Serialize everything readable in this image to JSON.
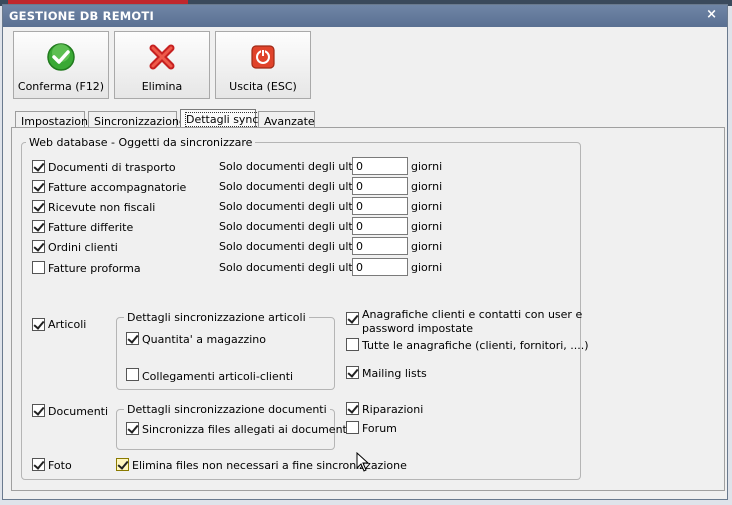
{
  "window": {
    "title": "GESTIONE DB REMOTI",
    "close_glyph": "×"
  },
  "toolbar": {
    "confirm_label": "Conferma (F12)",
    "delete_label": "Elimina",
    "exit_label": "Uscita (ESC)",
    "icons": {
      "confirm": "green-check-icon",
      "delete": "red-x-icon",
      "exit": "power-exit-icon"
    }
  },
  "tabs": [
    {
      "label": "Impostazioni",
      "active": false
    },
    {
      "label": "Sincronizzazione",
      "active": false
    },
    {
      "label": "Dettagli sync",
      "active": true
    },
    {
      "label": "Avanzate",
      "active": false
    }
  ],
  "main_group": {
    "title": "Web database - Oggetti da sincronizzare"
  },
  "documents": [
    {
      "label": "Documenti di trasporto",
      "checked": true,
      "prefix": "Solo documenti degli ultimi",
      "value": "0",
      "suffix": "giorni"
    },
    {
      "label": "Fatture accompagnatorie",
      "checked": true,
      "prefix": "Solo documenti degli ultimi",
      "value": "0",
      "suffix": "giorni"
    },
    {
      "label": "Ricevute non fiscali",
      "checked": true,
      "prefix": "Solo documenti degli ultimi",
      "value": "0",
      "suffix": "giorni"
    },
    {
      "label": "Fatture differite",
      "checked": true,
      "prefix": "Solo documenti degli ultimi",
      "value": "0",
      "suffix": "giorni"
    },
    {
      "label": "Ordini clienti",
      "checked": true,
      "prefix": "Solo documenti degli ultimi",
      "value": "0",
      "suffix": "giorni"
    },
    {
      "label": "Fatture proforma",
      "checked": false,
      "prefix": "Solo documenti degli ultimi",
      "value": "0",
      "suffix": "giorni"
    }
  ],
  "articoli": {
    "label": "Articoli",
    "checked": true
  },
  "articoli_details": {
    "title": "Dettagli sincronizzazione articoli",
    "qty_label": "Quantita' a magazzino",
    "qty_checked": true,
    "links_label": "Collegamenti articoli-clienti",
    "links_checked": false
  },
  "documenti": {
    "label": "Documenti",
    "checked": true
  },
  "documenti_details": {
    "title": "Dettagli sincronizzazione documenti",
    "files_label": "Sincronizza files allegati ai documenti",
    "files_checked": true
  },
  "foto": {
    "label": "Foto",
    "checked": true
  },
  "delete_files": {
    "label": "Elimina files non necessari a fine sincronizzazione",
    "checked": true
  },
  "right_options": {
    "anagrafiche_user": {
      "label_line1": "Anagrafiche clienti e contatti con user e",
      "label_line2": "password impostate",
      "checked": true
    },
    "all_anagrafiche": {
      "label": "Tutte le anagrafiche (clienti, fornitori, ....)",
      "checked": false
    },
    "mailing": {
      "label": "Mailing lists",
      "checked": true
    },
    "riparazioni": {
      "label": "Riparazioni",
      "checked": true
    },
    "forum": {
      "label": "Forum",
      "checked": false
    }
  }
}
